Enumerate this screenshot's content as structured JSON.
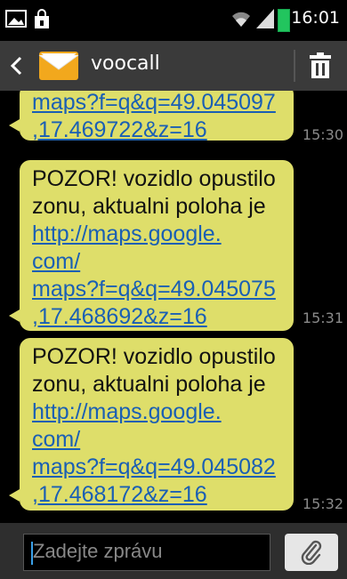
{
  "status_bar": {
    "time": "16:01",
    "icons": [
      "image-icon",
      "bag-icon",
      "wifi-icon",
      "signal-icon",
      "battery-icon"
    ]
  },
  "header": {
    "title": "voocall",
    "icons": [
      "back-icon",
      "envelope-icon",
      "trash-icon"
    ]
  },
  "messages": [
    {
      "text": "",
      "link_lines": [
        "maps?f=q&q=49.045097",
        ",17.469722&z=16"
      ],
      "time": "15:30"
    },
    {
      "text_lines": [
        "POZOR! vozidlo opustilo",
        "zonu, aktualni poloha je"
      ],
      "link_lines": [
        "http://maps.google.",
        "com/",
        "maps?f=q&q=49.045075",
        ",17.468692&z=16"
      ],
      "time": "15:31"
    },
    {
      "text_lines": [
        "POZOR! vozidlo opustilo",
        "zonu, aktualni poloha je"
      ],
      "link_lines": [
        "http://maps.google.",
        "com/",
        "maps?f=q&q=49.045082",
        ",17.468172&z=16"
      ],
      "time": "15:32"
    }
  ],
  "composer": {
    "placeholder": "Zadejte zprávu",
    "attach_icon": "paperclip-icon"
  },
  "colors": {
    "bubble": "#dede6a",
    "link": "#1a5fb4",
    "header_bg": "#3a3a3a",
    "battery": "#22c55e"
  }
}
